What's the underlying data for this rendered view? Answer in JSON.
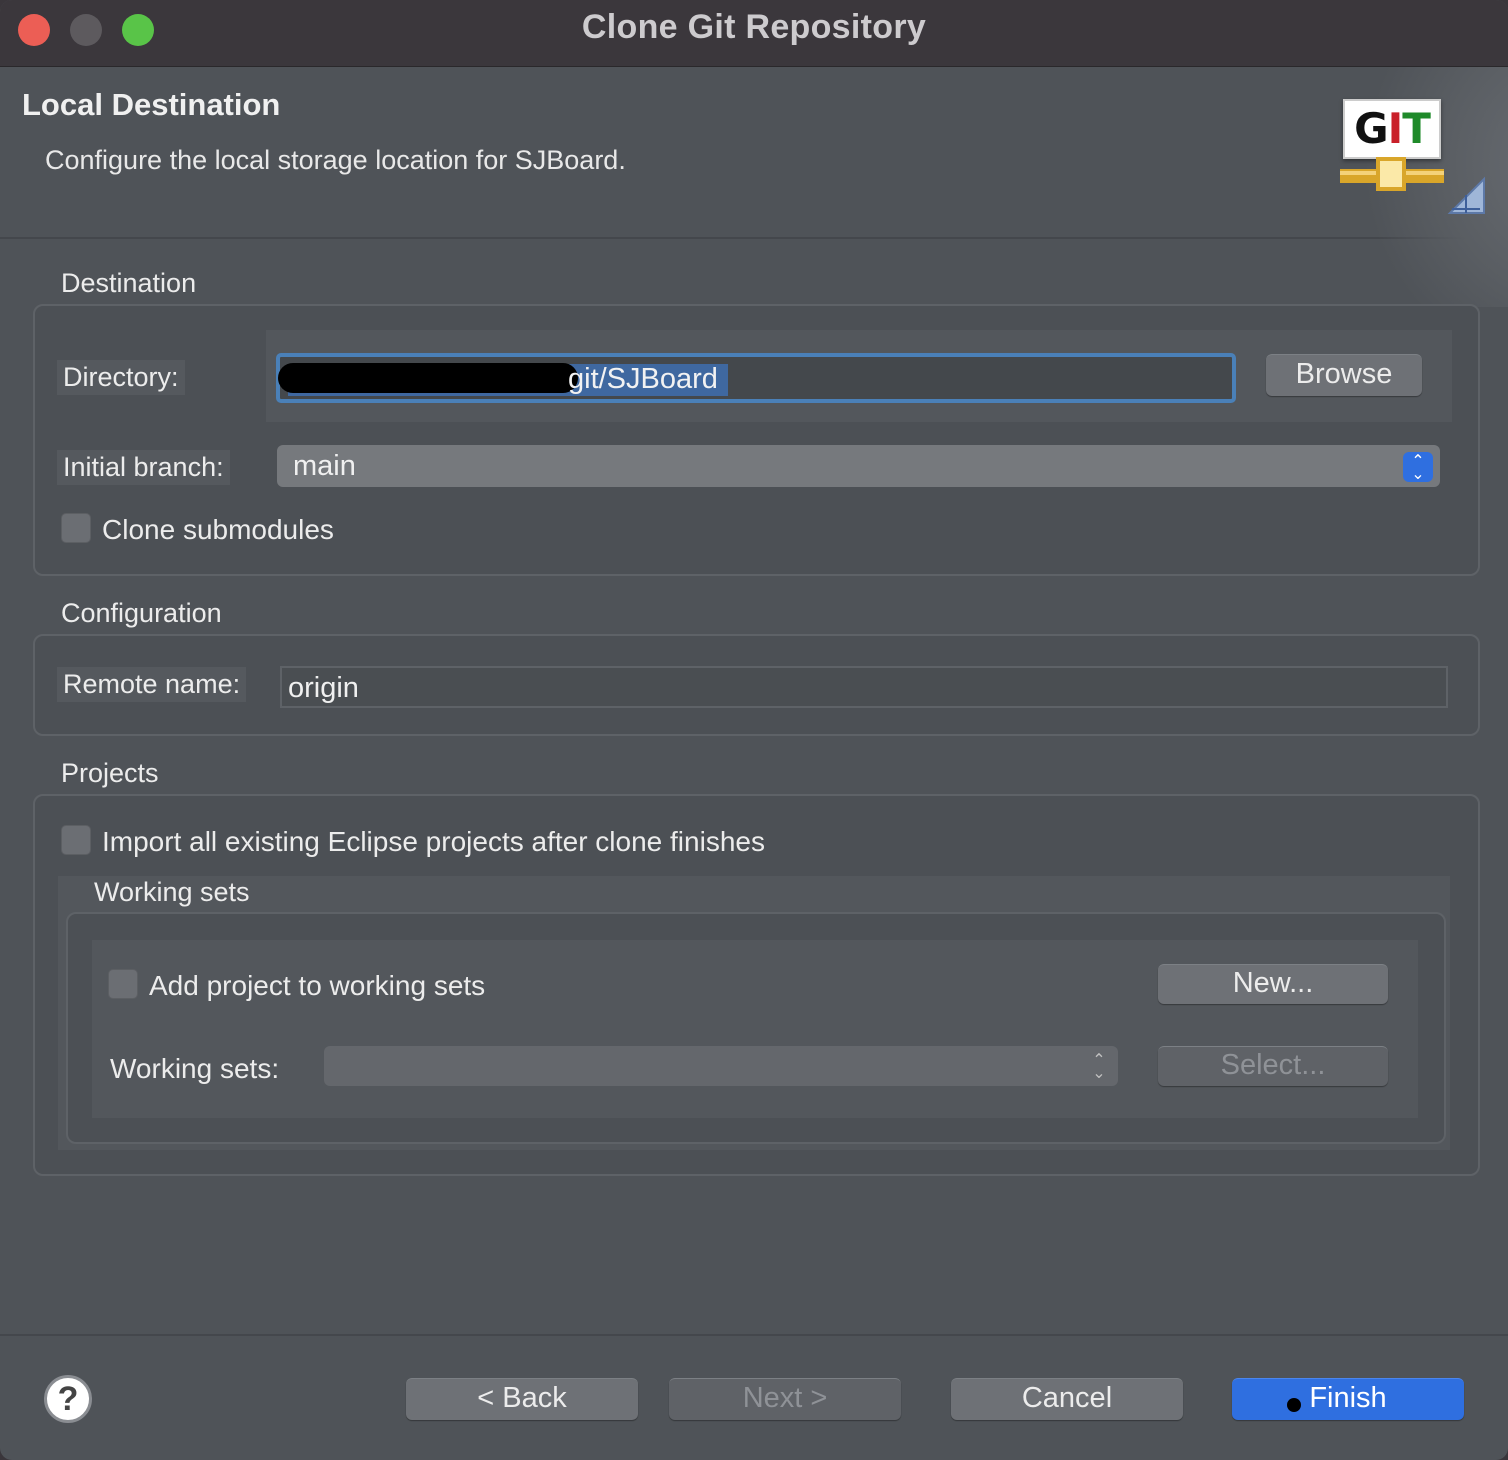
{
  "window": {
    "title": "Clone Git Repository",
    "controls": [
      "close",
      "minimize",
      "maximize"
    ]
  },
  "header": {
    "title": "Local Destination",
    "description": "Configure the local storage location for SJBoard.",
    "logo_text": "GIT"
  },
  "destination": {
    "group_label": "Destination",
    "directory_label": "Directory:",
    "directory_value_visible": "git/SJBoard",
    "browse_label": "Browse",
    "initial_branch_label": "Initial branch:",
    "initial_branch_value": "main",
    "clone_submodules_label": "Clone submodules",
    "clone_submodules_checked": false
  },
  "configuration": {
    "group_label": "Configuration",
    "remote_name_label": "Remote name:",
    "remote_name_value": "origin"
  },
  "projects": {
    "group_label": "Projects",
    "import_label": "Import all existing Eclipse projects after clone finishes",
    "import_checked": false,
    "working_sets": {
      "group_label": "Working sets",
      "add_label": "Add project to working sets",
      "add_checked": false,
      "new_label": "New...",
      "field_label": "Working sets:",
      "field_value": "",
      "select_label": "Select..."
    }
  },
  "footer": {
    "back_label": "< Back",
    "next_label": "Next >",
    "cancel_label": "Cancel",
    "finish_label": "Finish",
    "help_glyph": "?"
  },
  "colors": {
    "accent": "#2f6fe0",
    "focus_ring": "#4a80b8",
    "window_bg": "#4f5358",
    "titlebar_bg": "#3b373c"
  }
}
